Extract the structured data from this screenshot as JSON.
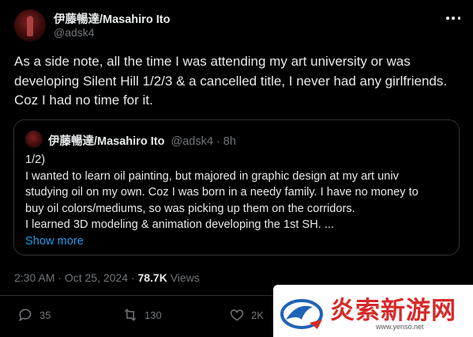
{
  "author": {
    "name": "伊藤暢達/Masahiro Ito",
    "handle": "@adsk4"
  },
  "tweet": {
    "lines": [
      "As a side note, all the time I was attending my art university or was",
      "developing Silent Hill 1/2/3 & a cancelled title, I never had any girlfriends.",
      "Coz I had no time for it."
    ]
  },
  "quote": {
    "name": "伊藤暢達/Masahiro Ito",
    "meta": "@adsk4 · 8h",
    "lines": [
      "1/2)",
      "I wanted to learn oil painting, but majored in graphic design at my art univ",
      "studying oil on my own. Coz I was born in a needy family. I have no money to",
      "buy oil colors/mediums, so was picking up them on the corridors.",
      "I learned 3D modeling & animation developing the 1st SH. ..."
    ],
    "show_more": "Show more"
  },
  "meta": {
    "time": "2:30 AM",
    "sep": " · ",
    "date": "Oct 25, 2024",
    "views_count": "78.7K",
    "views_label": " Views"
  },
  "actions": {
    "replies": "35",
    "reposts": "130",
    "likes": "2K"
  },
  "watermark": {
    "text": "炎索新游网",
    "url": "www.yenso.net"
  },
  "colors": {
    "background": "#000000",
    "text": "#e7e9ea",
    "secondary": "#71767b",
    "link": "#1d9bf0",
    "border": "#2f3336",
    "watermark_red": "#d62a2a"
  }
}
